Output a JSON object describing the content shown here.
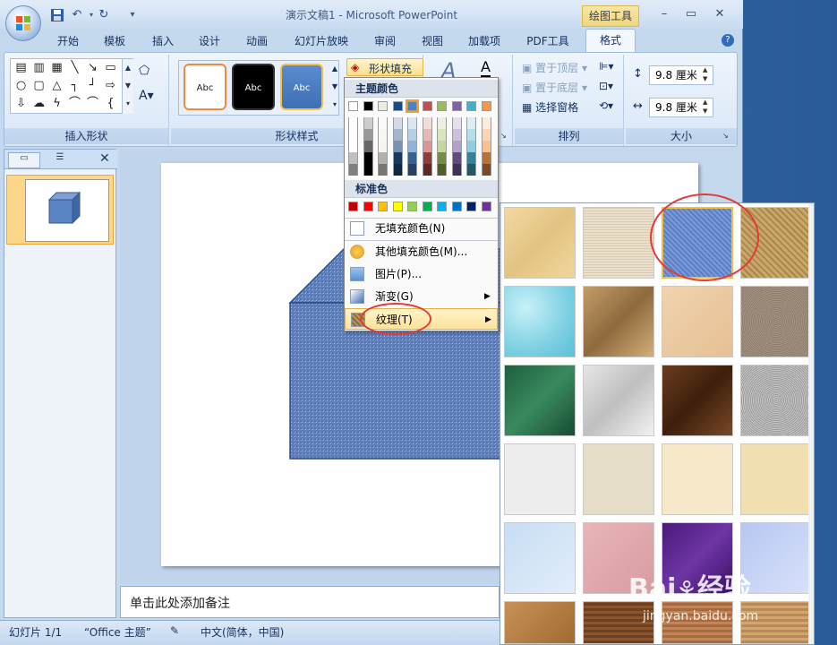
{
  "window": {
    "title": "演示文稿1 - Microsoft PowerPoint",
    "context_tab": "绘图工具"
  },
  "tabs": [
    "开始",
    "模板",
    "插入",
    "设计",
    "动画",
    "幻灯片放映",
    "审阅",
    "视图",
    "加载项",
    "PDF工具"
  ],
  "active_tab": "格式",
  "ribbon": {
    "shape_styles": [
      "Abc",
      "Abc",
      "Abc"
    ],
    "fill_button": "形状填充",
    "bring_front": "置于顶层",
    "send_back": "置于底层",
    "selection_pane": "选择窗格",
    "height_value": "9.8 厘米",
    "width_value": "9.8 厘米",
    "groups": {
      "insert_shapes": "插入形状",
      "shape_styles": "形状样式",
      "arrange": "排列",
      "size": "大小"
    }
  },
  "dropdown": {
    "theme_header": "主题颜色",
    "standard_header": "标准色",
    "no_fill": "无填充颜色(N)",
    "more_colors": "其他填充颜色(M)...",
    "picture": "图片(P)...",
    "gradient": "渐变(G)",
    "texture": "纹理(T)",
    "theme_colors": [
      "#ffffff",
      "#000000",
      "#eeece1",
      "#1f497d",
      "#4f81bd",
      "#c0504d",
      "#9bbb59",
      "#8064a2",
      "#4bacc6",
      "#f79646"
    ],
    "standard_colors": [
      "#c00000",
      "#ff0000",
      "#ffc000",
      "#ffff00",
      "#92d050",
      "#00b050",
      "#00b0f0",
      "#0070c0",
      "#002060",
      "#7030a0"
    ]
  },
  "slide_panel": {
    "slide_number": "1"
  },
  "notes": {
    "placeholder": "单击此处添加备注"
  },
  "status": {
    "slide": "幻灯片 1/1",
    "theme": "“Office 主题”",
    "language": "中文(简体，中国)"
  },
  "watermark": {
    "site": "jingyan.baidu.com"
  }
}
